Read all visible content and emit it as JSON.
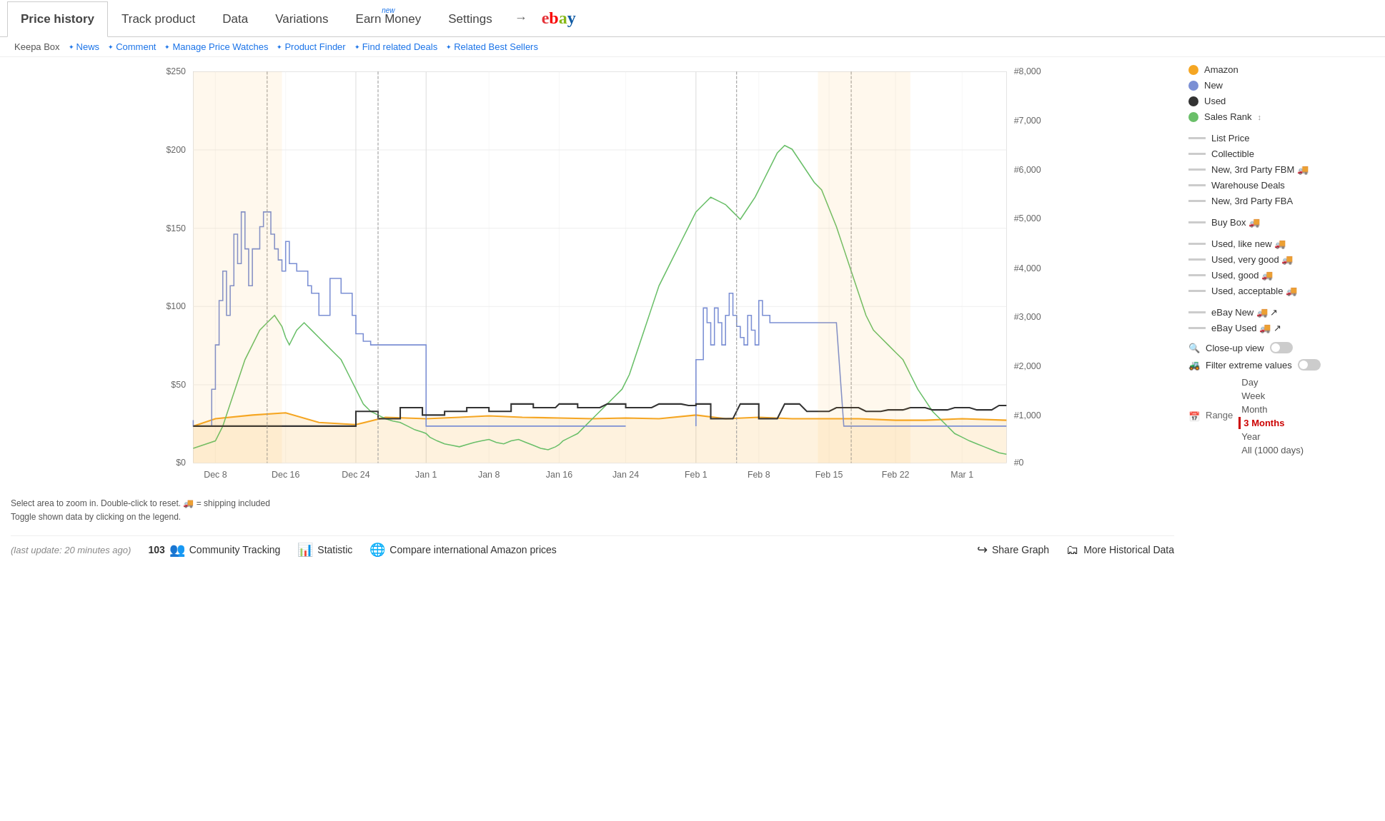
{
  "nav": {
    "tabs": [
      {
        "label": "Price history",
        "active": true
      },
      {
        "label": "Track product",
        "active": false
      },
      {
        "label": "Data",
        "active": false
      },
      {
        "label": "Variations",
        "active": false
      },
      {
        "label": "Earn Money",
        "active": false,
        "badge": "new"
      },
      {
        "label": "Settings",
        "active": false
      }
    ],
    "ebay_label": "ebay"
  },
  "toolbar": {
    "keepa_box": "Keepa Box",
    "items": [
      "News",
      "Comment",
      "Manage Price Watches",
      "Product Finder",
      "Find related Deals",
      "Related Best Sellers"
    ]
  },
  "legend": {
    "items": [
      {
        "label": "Amazon",
        "type": "dot",
        "color": "#f5a623"
      },
      {
        "label": "New",
        "type": "dot",
        "color": "#7b8fd4"
      },
      {
        "label": "Used",
        "type": "dot",
        "color": "#333333"
      },
      {
        "label": "Sales Rank",
        "type": "dot",
        "color": "#6abf69"
      },
      {
        "label": "List Price",
        "type": "dash",
        "color": "#aaaaaa"
      },
      {
        "label": "Collectible",
        "type": "dash",
        "color": "#aaaaaa"
      },
      {
        "label": "New, 3rd Party FBM 🚚",
        "type": "dash",
        "color": "#aaaaaa"
      },
      {
        "label": "Warehouse Deals",
        "type": "dash",
        "color": "#aaaaaa"
      },
      {
        "label": "New, 3rd Party FBA",
        "type": "dash",
        "color": "#aaaaaa"
      },
      {
        "label": "Buy Box 🚚",
        "type": "dash",
        "color": "#aaaaaa"
      },
      {
        "label": "Used, like new 🚚",
        "type": "dash",
        "color": "#aaaaaa"
      },
      {
        "label": "Used, very good 🚚",
        "type": "dash",
        "color": "#aaaaaa"
      },
      {
        "label": "Used, good 🚚",
        "type": "dash",
        "color": "#aaaaaa"
      },
      {
        "label": "Used, acceptable 🚚",
        "type": "dash",
        "color": "#aaaaaa"
      },
      {
        "label": "eBay New 🚚 ↗",
        "type": "dash",
        "color": "#aaaaaa"
      },
      {
        "label": "eBay Used 🚚 ↗",
        "type": "dash",
        "color": "#aaaaaa"
      }
    ],
    "controls": [
      {
        "icon": "🔍",
        "label": "Close-up view",
        "type": "toggle",
        "value": false
      },
      {
        "icon": "🚜",
        "label": "Filter extreme values",
        "type": "toggle",
        "value": false
      }
    ],
    "range": {
      "label": "Range",
      "options": [
        "Day",
        "Week",
        "Month",
        "3 Months",
        "Year",
        "All (1000 days)"
      ],
      "active": "3 Months"
    }
  },
  "chart": {
    "y_left_labels": [
      "$250",
      "$200",
      "$150",
      "$100",
      "$50",
      "$0"
    ],
    "y_right_labels": [
      "#8,000",
      "#7,000",
      "#6,000",
      "#5,000",
      "#4,000",
      "#3,000",
      "#2,000",
      "#1,000",
      "#0"
    ],
    "x_labels": [
      "Dec 8",
      "Dec 16",
      "Dec 24",
      "Jan 1",
      "Jan 8",
      "Jan 16",
      "Jan 24",
      "Feb 1",
      "Feb 8",
      "Feb 15",
      "Feb 22",
      "Mar 1"
    ]
  },
  "footer": {
    "last_update": "(last update: 20 minutes ago)",
    "community_count": "103",
    "community_label": "Community Tracking",
    "statistic_label": "Statistic",
    "compare_label": "Compare international Amazon prices",
    "share_label": "Share Graph",
    "more_label": "More Historical Data"
  },
  "footnotes": {
    "line1": "Select area to zoom in. Double-click to reset.  🚚 = shipping included",
    "line2": "Toggle shown data by clicking on the legend."
  }
}
